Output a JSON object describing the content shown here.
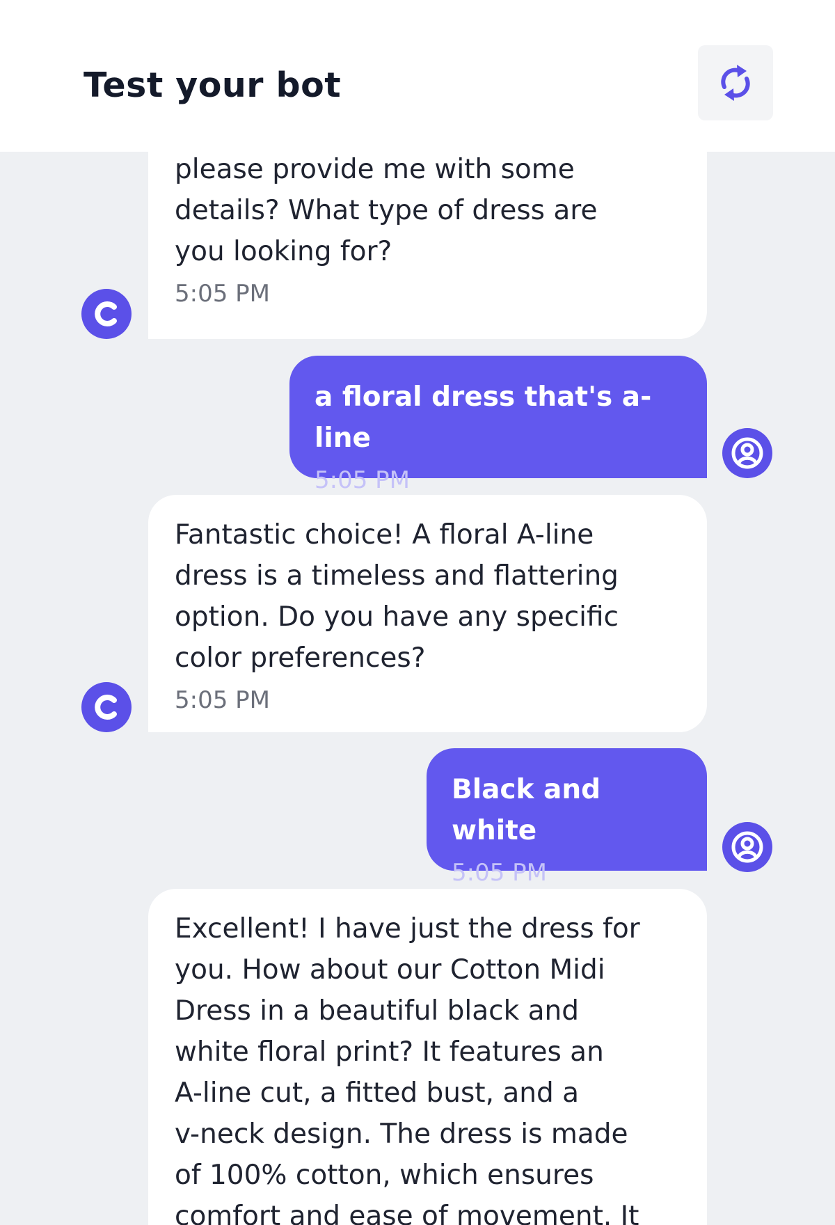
{
  "header": {
    "title": "Test your bot",
    "refresh_icon": "refresh-icon"
  },
  "colors": {
    "accent": "#6258ee",
    "avatar": "#5b50e8",
    "background": "#eef0f3"
  },
  "messages": [
    {
      "sender": "bot",
      "text": "please provide me with some\ndetails? What type of dress are\nyou looking for?",
      "time": "5:05 PM",
      "avatar_icon": "bot-logo-icon"
    },
    {
      "sender": "user",
      "text": "a floral dress that's a-line",
      "time": "5:05 PM",
      "avatar_icon": "user-icon"
    },
    {
      "sender": "bot",
      "text": "Fantastic choice! A floral A-line\ndress is a timeless and flattering\noption. Do you have any specific\ncolor preferences?",
      "time": "5:05 PM",
      "avatar_icon": "bot-logo-icon"
    },
    {
      "sender": "user",
      "text": "Black and white",
      "time": "5:05 PM",
      "avatar_icon": "user-icon"
    },
    {
      "sender": "bot",
      "text": "Excellent! I have just the dress for\nyou. How about our Cotton Midi\nDress in a beautiful black and\nwhite floral print? It features an\nA-line cut, a fitted bust, and a\nv-neck design. The dress is made\nof 100% cotton, which ensures\ncomfort and ease of movement. It",
      "time": "",
      "avatar_icon": "bot-logo-icon"
    }
  ]
}
